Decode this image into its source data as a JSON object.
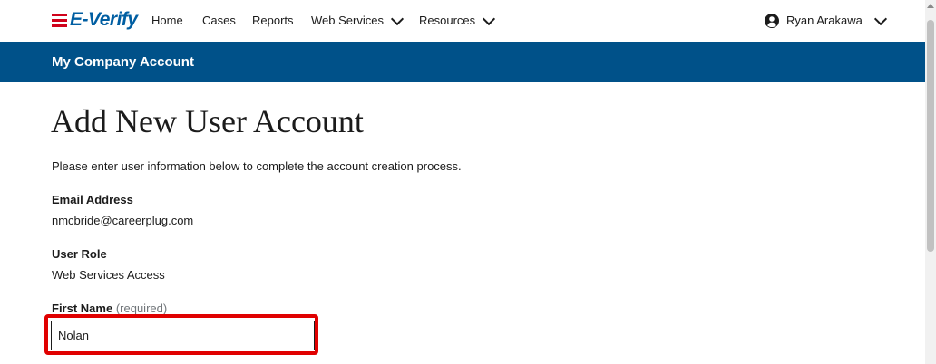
{
  "nav": {
    "logo_text": "E-Verify",
    "items": [
      {
        "label": "Home"
      },
      {
        "label": "Cases"
      },
      {
        "label": "Reports"
      },
      {
        "label": "Web Services"
      },
      {
        "label": "Resources"
      }
    ],
    "user_name": "Ryan Arakawa"
  },
  "banner": {
    "title": "My Company Account"
  },
  "main": {
    "title": "Add New User Account",
    "intro": "Please enter user information below to complete the account creation process.",
    "email": {
      "label": "Email Address",
      "value": "nmcbride@careerplug.com"
    },
    "role": {
      "label": "User Role",
      "value": "Web Services Access"
    },
    "first_name": {
      "label": "First Name",
      "required_text": "(required)",
      "value": "Nolan"
    }
  },
  "colors": {
    "brand_blue": "#005189",
    "logo_blue": "#005ea2",
    "logo_red": "#d0021b",
    "highlight_red": "#e00000"
  },
  "icons": {
    "user": "user-circle-icon",
    "chevron": "chevron-down-icon"
  }
}
